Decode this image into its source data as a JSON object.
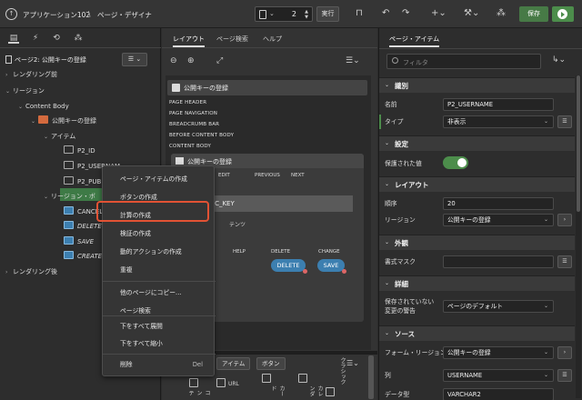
{
  "topbar": {
    "logo_glyph": "↑",
    "app_name": "アプリケーション102",
    "separator": "\\",
    "page_designer": "ページ・デザイナ",
    "page_number": "2",
    "run_label": "実行",
    "save_label": "保存",
    "icons": [
      "lock-icon",
      "undo-icon",
      "redo-icon",
      "plus-icon",
      "wrench-icon",
      "shared-components-icon",
      "run-icon"
    ]
  },
  "left_panel": {
    "root": "ページ2: 公開キーの登録",
    "tree": [
      {
        "label": "レンダリング前",
        "level": 0
      },
      {
        "label": "リージョン",
        "level": 0
      },
      {
        "label": "Content Body",
        "level": 1
      },
      {
        "label": "公開キーの登録",
        "level": 2
      },
      {
        "label": "アイテム",
        "level": 3
      },
      {
        "label": "P2_ID",
        "level": 4
      },
      {
        "label": "P2_USERNAME",
        "level": 4
      },
      {
        "label": "P2_PUBLIC_KEY",
        "level": 4
      },
      {
        "label": "リージョン・ボタン",
        "level": 3
      },
      {
        "label": "CANCEL",
        "level": 4
      },
      {
        "label": "DELETE",
        "level": 4
      },
      {
        "label": "SAVE",
        "level": 4
      },
      {
        "label": "CREATE",
        "level": 4
      },
      {
        "label": "レンダリング後",
        "level": 0
      }
    ],
    "visible_tree_labels": [
      "レンダリング前",
      "リージョン",
      "Content Body",
      "公開キーの登録",
      "アイテム",
      "P2_ID",
      "P2_USERNAM",
      "P2_PUBL",
      "リージョン・ボ",
      "CANCEL",
      "DELETE",
      "SAVE",
      "CREATE",
      "レンダリング後"
    ]
  },
  "middle_panel": {
    "tabs": [
      "レイアウト",
      "ページ検索",
      "ヘルプ"
    ],
    "region_title": "公開キーの登録",
    "slots": [
      "PAGE HEADER",
      "PAGE NAVIGATION",
      "BREADCRUMB BAR",
      "BEFORE CONTENT BODY",
      "CONTENT BODY"
    ],
    "inner_region_title": "公開キーの登録",
    "positions": [
      "EDIT",
      "PREVIOUS",
      "NEXT"
    ],
    "item_label": "IC_KEY",
    "item_sub": "テンツ",
    "button_positions": [
      "HELP",
      "DELETE",
      "CHANGE"
    ],
    "buttons": [
      "DELETE",
      "SAVE"
    ],
    "bottom_tabs": [
      "アイテム",
      "ボタン"
    ],
    "gallery": [
      "コンテ",
      "URL",
      "カード",
      "カレンダ",
      "クラシック"
    ]
  },
  "context_menu": {
    "items": [
      {
        "label": "ページ・アイテムの作成",
        "shortcut": ""
      },
      {
        "label": "ボタンの作成",
        "shortcut": ""
      },
      {
        "label": "計算の作成",
        "shortcut": ""
      },
      {
        "label": "検証の作成",
        "shortcut": ""
      },
      {
        "label": "動的アクションの作成",
        "shortcut": ""
      },
      {
        "label": "重複",
        "shortcut": ""
      },
      {
        "label": "他のページにコピー...",
        "shortcut": ""
      },
      {
        "label": "ページ検索",
        "shortcut": ""
      },
      {
        "label": "下をすべて展開",
        "shortcut": ""
      },
      {
        "label": "下をすべて縮小",
        "shortcut": ""
      },
      {
        "label": "削除",
        "shortcut": "Del"
      }
    ],
    "highlight_color": "#e25234"
  },
  "right_panel": {
    "tab": "ページ・アイテム",
    "filter_placeholder": "フィルタ",
    "sections": {
      "identification": "識別",
      "settings": "設定",
      "layout": "レイアウト",
      "appearance": "外観",
      "advanced": "詳細",
      "source": "ソース"
    },
    "fields": {
      "name_label": "名前",
      "name_value": "P2_USERNAME",
      "type_label": "タイプ",
      "type_value": "非表示",
      "protected_label": "保護された値",
      "sequence_label": "順序",
      "sequence_value": "20",
      "region_label": "リージョン",
      "region_value": "公開キーの登録",
      "template_label": "書式マスク",
      "warn_label_1": "保存されていない",
      "warn_label_2": "変更の警告",
      "warn_value": "ページのデフォルト",
      "form_region_label": "フォーム・リージョン",
      "form_region_value": "公開キーの登録",
      "column_label": "列",
      "column_value": "USERNAME",
      "datatype_label": "データ型",
      "datatype_value": "VARCHAR2"
    },
    "toggle_on": true
  },
  "colors": {
    "accent_green": "#4c8d4b",
    "selection_green": "#3e7a46",
    "button_blue": "#3c7fb0",
    "region_orange": "#d46a3e"
  }
}
